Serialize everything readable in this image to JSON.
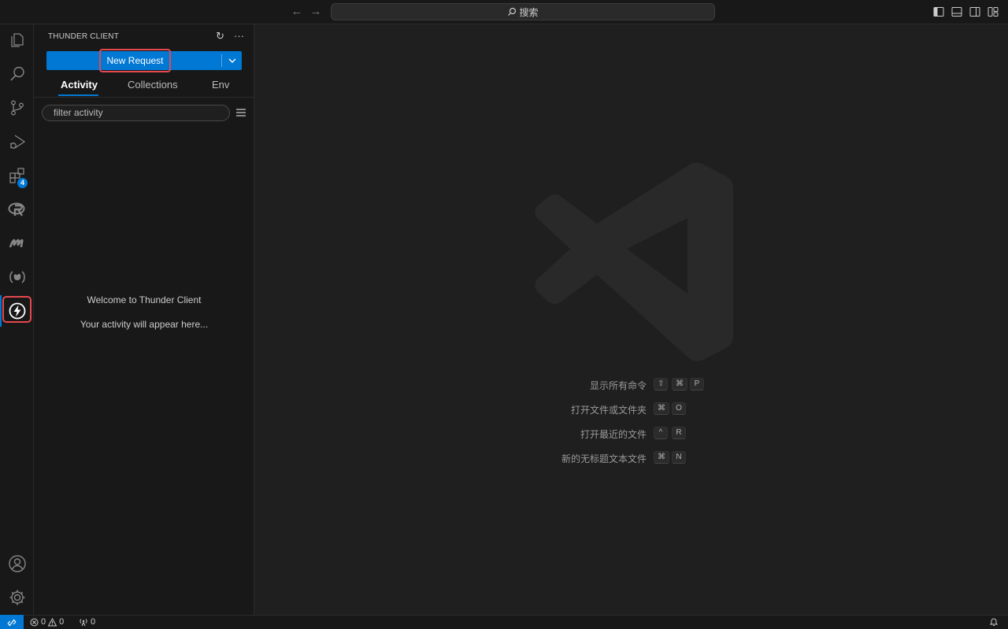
{
  "titlebar": {
    "search_label": "搜索",
    "icons": [
      "arrow-left-icon",
      "arrow-right-icon",
      "toggle-primary-sidebar-icon",
      "toggle-panel-icon",
      "toggle-secondary-sidebar-icon",
      "customize-layout-icon"
    ]
  },
  "activitybar": {
    "items": [
      {
        "name": "explorer-icon"
      },
      {
        "name": "search-icon"
      },
      {
        "name": "source-control-icon"
      },
      {
        "name": "run-debug-icon"
      },
      {
        "name": "extensions-icon",
        "badge": "4"
      },
      {
        "name": "r-language-icon"
      },
      {
        "name": "modelica-icon"
      },
      {
        "name": "remote-explorer-icon"
      },
      {
        "name": "thunder-client-icon",
        "active": true
      }
    ],
    "bottom": [
      {
        "name": "accounts-icon"
      },
      {
        "name": "manage-gear-icon"
      }
    ]
  },
  "sidebar": {
    "title": "THUNDER CLIENT",
    "new_request_label": "New Request",
    "tabs": [
      {
        "label": "Activity",
        "active": true
      },
      {
        "label": "Collections"
      },
      {
        "label": "Env"
      }
    ],
    "filter_placeholder": "filter activity",
    "welcome_title": "Welcome to Thunder Client",
    "welcome_text": "Your activity will appear here..."
  },
  "editor": {
    "shortcuts": [
      {
        "label": "显示所有命令",
        "keys": [
          "⇧",
          "⌘",
          "P"
        ]
      },
      {
        "label": "打开文件或文件夹",
        "keys": [
          "⌘",
          "O"
        ]
      },
      {
        "label": "打开最近的文件",
        "keys": [
          "^",
          "R"
        ]
      },
      {
        "label": "新的无标题文本文件",
        "keys": [
          "⌘",
          "N"
        ]
      }
    ]
  },
  "statusbar": {
    "errors": "0",
    "warnings": "0",
    "ports": "0"
  },
  "colors": {
    "accent": "#0078d4",
    "highlight": "#e5484d",
    "background": "#1f1f1f",
    "sidebar_bg": "#181818"
  }
}
